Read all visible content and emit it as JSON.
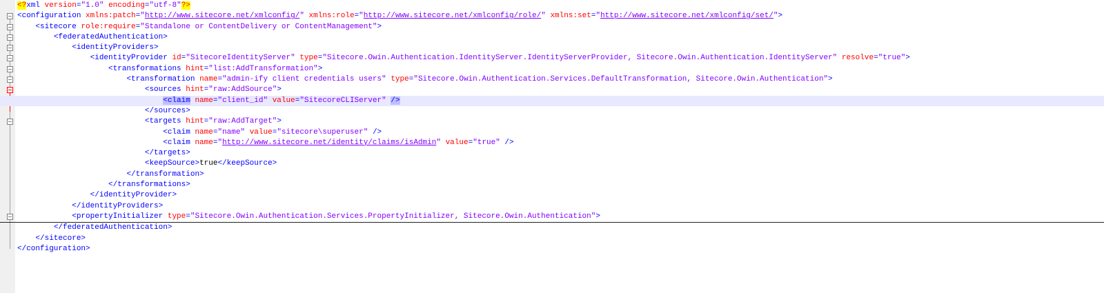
{
  "editor": {
    "colors": {
      "tag": "#0000ff",
      "attribute": "#ff0000",
      "value": "#8000ff",
      "text": "#000000",
      "current_line": "#e8e8ff",
      "declaration_highlight": "#ffff00",
      "selection": "#c0c0ff",
      "change_marker": "#00a000"
    },
    "lines": [
      [
        {
          "t": "<?",
          "c": "t-decl"
        },
        {
          "t": "xml ",
          "c": "t-tag"
        },
        {
          "t": "version",
          "c": "t-attr"
        },
        {
          "t": "=",
          "c": "t-tag"
        },
        {
          "t": "\"1.0\"",
          "c": "t-val"
        },
        {
          "t": " ",
          "c": "t-tag"
        },
        {
          "t": "encoding",
          "c": "t-attr"
        },
        {
          "t": "=",
          "c": "t-tag"
        },
        {
          "t": "\"utf-8\"",
          "c": "t-val"
        },
        {
          "t": "?>",
          "c": "t-decl"
        }
      ],
      [
        {
          "t": "<configuration ",
          "c": "t-tag"
        },
        {
          "t": "xmlns:patch",
          "c": "t-attr"
        },
        {
          "t": "=",
          "c": "t-tag"
        },
        {
          "t": "\"",
          "c": "t-val"
        },
        {
          "t": "http://www.sitecore.net/xmlconfig/",
          "c": "t-url"
        },
        {
          "t": "\"",
          "c": "t-val"
        },
        {
          "t": " ",
          "c": "t-tag"
        },
        {
          "t": "xmlns:role",
          "c": "t-attr"
        },
        {
          "t": "=",
          "c": "t-tag"
        },
        {
          "t": "\"",
          "c": "t-val"
        },
        {
          "t": "http://www.sitecore.net/xmlconfig/role/",
          "c": "t-url"
        },
        {
          "t": "\"",
          "c": "t-val"
        },
        {
          "t": " ",
          "c": "t-tag"
        },
        {
          "t": "xmlns:set",
          "c": "t-attr"
        },
        {
          "t": "=",
          "c": "t-tag"
        },
        {
          "t": "\"",
          "c": "t-val"
        },
        {
          "t": "http://www.sitecore.net/xmlconfig/set/",
          "c": "t-url"
        },
        {
          "t": "\"",
          "c": "t-val"
        },
        {
          "t": ">",
          "c": "t-tag"
        }
      ],
      [
        {
          "t": "    ",
          "c": "t-text"
        },
        {
          "t": "<sitecore ",
          "c": "t-tag"
        },
        {
          "t": "role:require",
          "c": "t-attr"
        },
        {
          "t": "=",
          "c": "t-tag"
        },
        {
          "t": "\"Standalone or ContentDelivery or ContentManagement\"",
          "c": "t-val"
        },
        {
          "t": ">",
          "c": "t-tag"
        }
      ],
      [
        {
          "t": "        ",
          "c": "t-text"
        },
        {
          "t": "<federatedAuthentication>",
          "c": "t-tag"
        }
      ],
      [
        {
          "t": "            ",
          "c": "t-text"
        },
        {
          "t": "<identityProviders>",
          "c": "t-tag"
        }
      ],
      [
        {
          "t": "                ",
          "c": "t-text"
        },
        {
          "t": "<identityProvider ",
          "c": "t-tag"
        },
        {
          "t": "id",
          "c": "t-attr"
        },
        {
          "t": "=",
          "c": "t-tag"
        },
        {
          "t": "\"SitecoreIdentityServer\"",
          "c": "t-val"
        },
        {
          "t": " ",
          "c": "t-tag"
        },
        {
          "t": "type",
          "c": "t-attr"
        },
        {
          "t": "=",
          "c": "t-tag"
        },
        {
          "t": "\"Sitecore.Owin.Authentication.IdentityServer.IdentityServerProvider, Sitecore.Owin.Authentication.IdentityServer\"",
          "c": "t-val"
        },
        {
          "t": " ",
          "c": "t-tag"
        },
        {
          "t": "resolve",
          "c": "t-attr"
        },
        {
          "t": "=",
          "c": "t-tag"
        },
        {
          "t": "\"true\"",
          "c": "t-val"
        },
        {
          "t": ">",
          "c": "t-tag"
        }
      ],
      [
        {
          "t": "                    ",
          "c": "t-text"
        },
        {
          "t": "<transformations ",
          "c": "t-tag"
        },
        {
          "t": "hint",
          "c": "t-attr"
        },
        {
          "t": "=",
          "c": "t-tag"
        },
        {
          "t": "\"list:AddTransformation\"",
          "c": "t-val"
        },
        {
          "t": ">",
          "c": "t-tag"
        }
      ],
      [
        {
          "t": "                        ",
          "c": "t-text"
        },
        {
          "t": "<transformation ",
          "c": "t-tag"
        },
        {
          "t": "name",
          "c": "t-attr"
        },
        {
          "t": "=",
          "c": "t-tag"
        },
        {
          "t": "\"admin-ify client credentials users\"",
          "c": "t-val"
        },
        {
          "t": " ",
          "c": "t-tag"
        },
        {
          "t": "type",
          "c": "t-attr"
        },
        {
          "t": "=",
          "c": "t-tag"
        },
        {
          "t": "\"Sitecore.Owin.Authentication.Services.DefaultTransformation, Sitecore.Owin.Authentication\"",
          "c": "t-val"
        },
        {
          "t": ">",
          "c": "t-tag"
        }
      ],
      [
        {
          "t": "                            ",
          "c": "t-text"
        },
        {
          "t": "<sources ",
          "c": "t-tag"
        },
        {
          "t": "hint",
          "c": "t-attr"
        },
        {
          "t": "=",
          "c": "t-tag"
        },
        {
          "t": "\"raw:AddSource\"",
          "c": "t-val"
        },
        {
          "t": ">",
          "c": "t-tag"
        }
      ],
      [
        {
          "t": "                                ",
          "c": "t-text"
        },
        {
          "t": "<claim",
          "c": "t-tag t-sel"
        },
        {
          "t": " ",
          "c": "t-tag"
        },
        {
          "t": "name",
          "c": "t-attr"
        },
        {
          "t": "=",
          "c": "t-tag"
        },
        {
          "t": "\"client_id\"",
          "c": "t-val"
        },
        {
          "t": " ",
          "c": "t-tag"
        },
        {
          "t": "value",
          "c": "t-attr"
        },
        {
          "t": "=",
          "c": "t-tag"
        },
        {
          "t": "\"SitecoreCLIServer\"",
          "c": "t-val"
        },
        {
          "t": " ",
          "c": "t-tag"
        },
        {
          "t": "/>",
          "c": "t-tag t-sel"
        }
      ],
      [
        {
          "t": "                            ",
          "c": "t-text"
        },
        {
          "t": "</sources>",
          "c": "t-tag"
        }
      ],
      [
        {
          "t": "                            ",
          "c": "t-text"
        },
        {
          "t": "<targets ",
          "c": "t-tag"
        },
        {
          "t": "hint",
          "c": "t-attr"
        },
        {
          "t": "=",
          "c": "t-tag"
        },
        {
          "t": "\"raw:AddTarget\"",
          "c": "t-val"
        },
        {
          "t": ">",
          "c": "t-tag"
        }
      ],
      [
        {
          "t": "                                ",
          "c": "t-text"
        },
        {
          "t": "<claim ",
          "c": "t-tag"
        },
        {
          "t": "name",
          "c": "t-attr"
        },
        {
          "t": "=",
          "c": "t-tag"
        },
        {
          "t": "\"name\"",
          "c": "t-val"
        },
        {
          "t": " ",
          "c": "t-tag"
        },
        {
          "t": "value",
          "c": "t-attr"
        },
        {
          "t": "=",
          "c": "t-tag"
        },
        {
          "t": "\"sitecore\\superuser\"",
          "c": "t-val"
        },
        {
          "t": " />",
          "c": "t-tag"
        }
      ],
      [
        {
          "t": "                                ",
          "c": "t-text"
        },
        {
          "t": "<claim ",
          "c": "t-tag"
        },
        {
          "t": "name",
          "c": "t-attr"
        },
        {
          "t": "=",
          "c": "t-tag"
        },
        {
          "t": "\"",
          "c": "t-val"
        },
        {
          "t": "http://www.sitecore.net/identity/claims/isAdmin",
          "c": "t-url"
        },
        {
          "t": "\"",
          "c": "t-val"
        },
        {
          "t": " ",
          "c": "t-tag"
        },
        {
          "t": "value",
          "c": "t-attr"
        },
        {
          "t": "=",
          "c": "t-tag"
        },
        {
          "t": "\"true\"",
          "c": "t-val"
        },
        {
          "t": " />",
          "c": "t-tag"
        }
      ],
      [
        {
          "t": "                            ",
          "c": "t-text"
        },
        {
          "t": "</targets>",
          "c": "t-tag"
        }
      ],
      [
        {
          "t": "                            ",
          "c": "t-text"
        },
        {
          "t": "<keepSource>",
          "c": "t-tag"
        },
        {
          "t": "true",
          "c": "t-text"
        },
        {
          "t": "</keepSource>",
          "c": "t-tag"
        }
      ],
      [
        {
          "t": "                        ",
          "c": "t-text"
        },
        {
          "t": "</transformation>",
          "c": "t-tag"
        }
      ],
      [
        {
          "t": "                    ",
          "c": "t-text"
        },
        {
          "t": "</transformations>",
          "c": "t-tag"
        }
      ],
      [
        {
          "t": "                ",
          "c": "t-text"
        },
        {
          "t": "</identityProvider>",
          "c": "t-tag"
        }
      ],
      [
        {
          "t": "            ",
          "c": "t-text"
        },
        {
          "t": "</identityProviders>",
          "c": "t-tag"
        }
      ],
      [
        {
          "t": "            ",
          "c": "t-text"
        },
        {
          "t": "<propertyInitializer ",
          "c": "t-tag"
        },
        {
          "t": "type",
          "c": "t-attr"
        },
        {
          "t": "=",
          "c": "t-tag"
        },
        {
          "t": "\"Sitecore.Owin.Authentication.Services.PropertyInitializer, Sitecore.Owin.Authentication\"",
          "c": "t-val"
        },
        {
          "t": ">",
          "c": "t-tag"
        }
      ],
      [
        {
          "t": "        ",
          "c": "t-text"
        },
        {
          "t": "</federatedAuthentication>",
          "c": "t-tag"
        }
      ],
      [
        {
          "t": "    ",
          "c": "t-text"
        },
        {
          "t": "</sitecore>",
          "c": "t-tag"
        }
      ],
      [
        {
          "t": "</configuration>",
          "c": "t-tag"
        }
      ]
    ]
  }
}
